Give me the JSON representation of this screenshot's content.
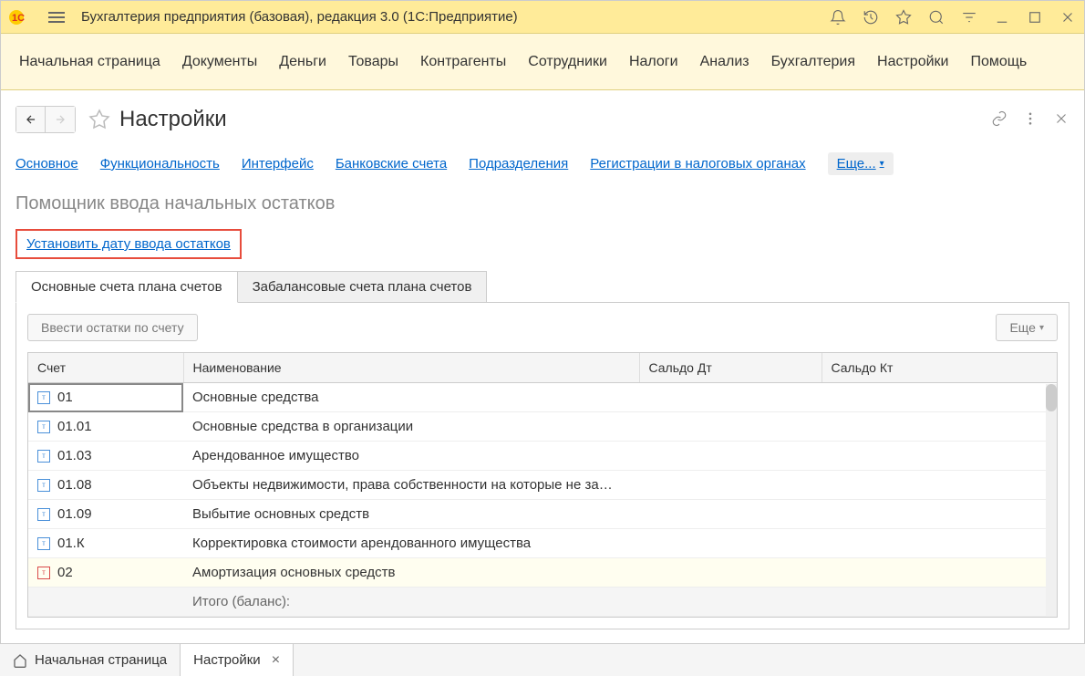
{
  "titlebar": {
    "title": "Бухгалтерия предприятия (базовая), редакция 3.0  (1С:Предприятие)"
  },
  "mainMenu": {
    "items": [
      "Начальная страница",
      "Документы",
      "Деньги",
      "Товары",
      "Контрагенты",
      "Сотрудники",
      "Налоги",
      "Анализ",
      "Бухгалтерия",
      "Настройки",
      "Помощь"
    ]
  },
  "page": {
    "title": "Настройки"
  },
  "subNav": {
    "links": [
      "Основное",
      "Функциональность",
      "Интерфейс",
      "Банковские счета",
      "Подразделения",
      "Регистрации в налоговых органах"
    ],
    "more": "Еще..."
  },
  "section": {
    "title": "Помощник ввода начальных остатков",
    "setDateLink": "Установить дату ввода остатков"
  },
  "tabs": {
    "items": [
      "Основные счета плана счетов",
      "Забалансовые счета плана счетов"
    ],
    "activeIndex": 0
  },
  "toolbar": {
    "enterBalances": "Ввести остатки по счету",
    "more": "Еще"
  },
  "table": {
    "headers": {
      "account": "Счет",
      "name": "Наименование",
      "debit": "Сальдо Дт",
      "credit": "Сальдо Кт"
    },
    "rows": [
      {
        "account": "01",
        "name": "Основные средства",
        "debit": "",
        "credit": "",
        "selected": true,
        "iconType": "blue"
      },
      {
        "account": "01.01",
        "name": "Основные средства в организации",
        "debit": "",
        "credit": "",
        "iconType": "blue"
      },
      {
        "account": "01.03",
        "name": "Арендованное имущество",
        "debit": "",
        "credit": "",
        "iconType": "blue"
      },
      {
        "account": "01.08",
        "name": "Объекты недвижимости, права собственности на которые не за…",
        "debit": "",
        "credit": "",
        "iconType": "blue"
      },
      {
        "account": "01.09",
        "name": "Выбытие основных средств",
        "debit": "",
        "credit": "",
        "iconType": "blue"
      },
      {
        "account": "01.К",
        "name": "Корректировка стоимости арендованного имущества",
        "debit": "",
        "credit": "",
        "iconType": "blue"
      },
      {
        "account": "02",
        "name": "Амортизация основных средств",
        "debit": "",
        "credit": "",
        "iconType": "red",
        "alt": true
      }
    ],
    "total": {
      "label": "Итого (баланс):",
      "debit": "",
      "credit": ""
    }
  },
  "bottomBar": {
    "home": "Начальная страница",
    "tab": "Настройки"
  }
}
